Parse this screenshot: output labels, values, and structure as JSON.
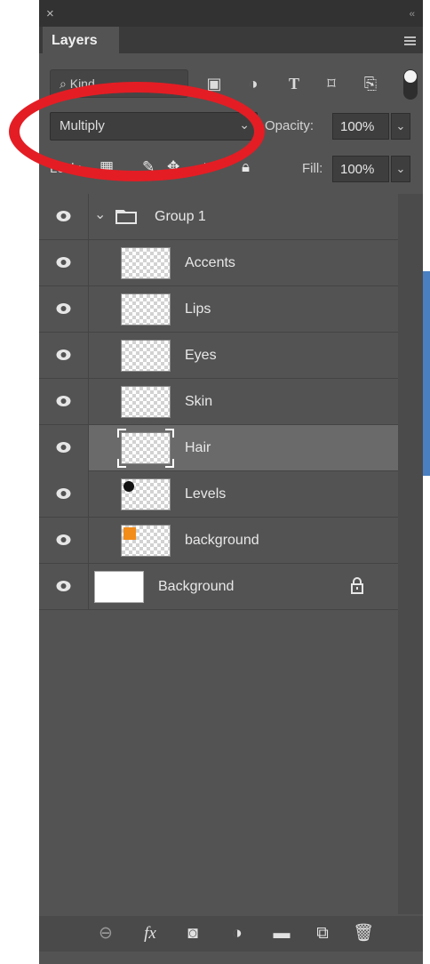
{
  "panel": {
    "close_glyph": "×",
    "collapse_glyph": "‹‹",
    "tab_label": "Layers"
  },
  "filter": {
    "kind_placeholder": "Kind",
    "icons": [
      "pixel-filter-icon",
      "adjustment-filter-icon",
      "type-filter-icon",
      "shape-filter-icon",
      "smart-object-filter-icon"
    ]
  },
  "blend": {
    "mode": "Multiply",
    "opacity_label": "Opacity:",
    "opacity_value": "100%"
  },
  "lock": {
    "label": "Lock:",
    "fill_label": "Fill:",
    "fill_value": "100%"
  },
  "layers": [
    {
      "name": "Group 1",
      "type": "group"
    },
    {
      "name": "Accents",
      "type": "layer"
    },
    {
      "name": "Lips",
      "type": "layer"
    },
    {
      "name": "Eyes",
      "type": "layer"
    },
    {
      "name": "Skin",
      "type": "layer"
    },
    {
      "name": "Hair",
      "type": "layer",
      "selected": true
    },
    {
      "name": "Levels",
      "type": "layer"
    },
    {
      "name": "background",
      "type": "layer"
    },
    {
      "name": "Background",
      "type": "locked"
    }
  ],
  "colors": {
    "panel_bg": "#535353",
    "highlight_ellipse": "#e41d24",
    "selected_row": "#6a6a6a",
    "orange_swatch": "#f28c1a"
  },
  "bottom_icons": [
    "link-icon",
    "fx-icon",
    "mask-icon",
    "adjustment-icon",
    "folder-icon",
    "new-layer-icon",
    "trash-icon"
  ],
  "bottom_fx": "fx"
}
